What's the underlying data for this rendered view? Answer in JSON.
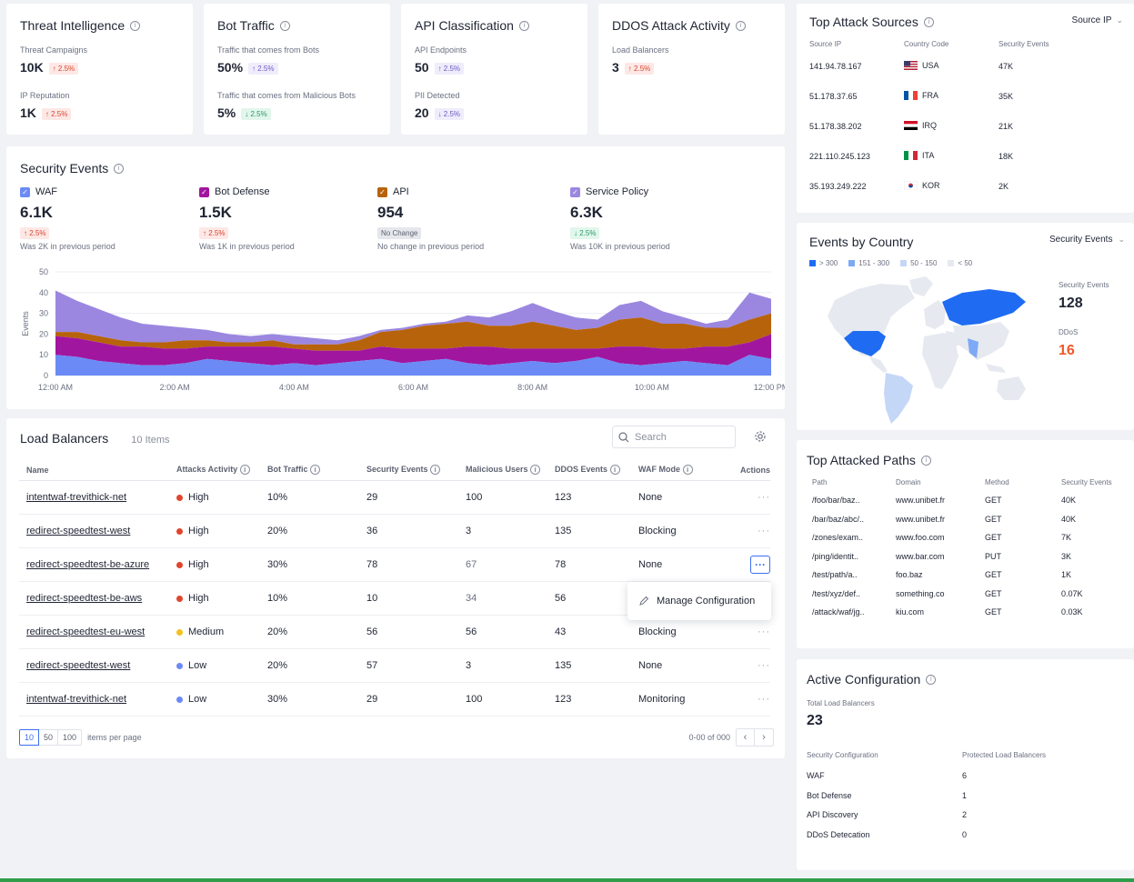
{
  "kpis": [
    {
      "title": "Threat Intelligence",
      "items": [
        {
          "label": "Threat Campaigns",
          "value": "10K",
          "delta": "↑ 2.5%",
          "tone": "red"
        },
        {
          "label": "IP Reputation",
          "value": "1K",
          "delta": "↑ 2.5%",
          "tone": "red"
        }
      ]
    },
    {
      "title": "Bot Traffic",
      "items": [
        {
          "label": "Traffic that comes from Bots",
          "value": "50%",
          "delta": "↑ 2.5%",
          "tone": "purple"
        },
        {
          "label": "Traffic that comes from Malicious Bots",
          "value": "5%",
          "delta": "↓ 2.5%",
          "tone": "green"
        }
      ]
    },
    {
      "title": "API Classification",
      "items": [
        {
          "label": "API Endpoints",
          "value": "50",
          "delta": "↑ 2.5%",
          "tone": "purple"
        },
        {
          "label": "PII Detected",
          "value": "20",
          "delta": "↓ 2.5%",
          "tone": "purple"
        }
      ]
    },
    {
      "title": "DDOS Attack Activity",
      "items": [
        {
          "label": "Load Balancers",
          "value": "3",
          "delta": "↑ 2.5%",
          "tone": "red"
        }
      ]
    }
  ],
  "security_events": {
    "title": "Security Events",
    "metrics": [
      {
        "label": "WAF",
        "value": "6.1K",
        "delta": "↑ 2.5%",
        "tone": "red",
        "note": "Was 2K in previous period",
        "color": "#6b8af5"
      },
      {
        "label": "Bot Defense",
        "value": "1.5K",
        "delta": "↑ 2.5%",
        "tone": "red",
        "note": "Was 1K in previous period",
        "color": "#a1169f"
      },
      {
        "label": "API",
        "value": "954",
        "delta": "No Change",
        "tone": "gray",
        "note": "No change in previous period",
        "color": "#b7630c"
      },
      {
        "label": "Service Policy",
        "value": "6.3K",
        "delta": "↓ 2.5%",
        "tone": "green",
        "note": "Was 10K in previous period",
        "color": "#9b87e0"
      }
    ]
  },
  "chart_data": {
    "type": "area",
    "ylabel": "Events",
    "xlabel": "",
    "ylim": [
      0,
      50
    ],
    "y_ticks": [
      "0",
      "10",
      "20",
      "30",
      "40",
      "50"
    ],
    "x_ticks": [
      "12:00 AM",
      "2:00 AM",
      "4:00 AM",
      "6:00 AM",
      "8:00 AM",
      "10:00 AM",
      "12:00 PM"
    ],
    "grid": true,
    "stacked": true,
    "series": [
      {
        "name": "WAF",
        "color": "#6b8af5",
        "values": [
          10,
          9,
          7,
          6,
          5,
          5,
          6,
          8,
          7,
          6,
          5,
          6,
          5,
          6,
          7,
          8,
          6,
          7,
          8,
          6,
          5,
          6,
          7,
          6,
          7,
          9,
          6,
          5,
          6,
          7,
          6,
          5,
          10,
          8
        ]
      },
      {
        "name": "Bot Defense",
        "color": "#a1169f",
        "values": [
          9,
          9,
          9,
          8,
          9,
          8,
          7,
          6,
          7,
          8,
          9,
          7,
          7,
          6,
          5,
          6,
          7,
          6,
          5,
          8,
          9,
          7,
          6,
          7,
          6,
          4,
          8,
          9,
          7,
          6,
          8,
          9,
          6,
          12
        ]
      },
      {
        "name": "API",
        "color": "#b7630c",
        "values": [
          2,
          3,
          3,
          3,
          2,
          3,
          4,
          3,
          2,
          2,
          3,
          2,
          3,
          3,
          5,
          7,
          9,
          11,
          12,
          12,
          10,
          11,
          13,
          11,
          9,
          10,
          13,
          14,
          12,
          12,
          9,
          9,
          11,
          10
        ]
      },
      {
        "name": "Service Policy",
        "color": "#9b87e0",
        "values": [
          20,
          15,
          13,
          11,
          9,
          8,
          6,
          5,
          4,
          3,
          3,
          4,
          3,
          2,
          2,
          1,
          1,
          1,
          1,
          3,
          4,
          7,
          9,
          7,
          6,
          4,
          7,
          8,
          6,
          3,
          2,
          4,
          13,
          7
        ]
      }
    ]
  },
  "load_balancers": {
    "title": "Load Balancers",
    "count": "10 Items",
    "search_placeholder": "Search",
    "columns": [
      "Name",
      "Attacks Activity",
      "Bot Traffic",
      "Security Events",
      "Malicious Users",
      "DDOS Events",
      "WAF Mode",
      "Actions"
    ],
    "rows": [
      {
        "name": "intentwaf-trevithick-net",
        "activity": "High",
        "bot": "10%",
        "events": "29",
        "users": "100",
        "ddos": "123",
        "mode": "None",
        "level": "high"
      },
      {
        "name": "redirect-speedtest-west",
        "activity": "High",
        "bot": "20%",
        "events": "36",
        "users": "3",
        "ddos": "135",
        "mode": "Blocking",
        "level": "high"
      },
      {
        "name": "redirect-speedtest-be-azure",
        "activity": "High",
        "bot": "30%",
        "events": "78",
        "users": "67",
        "ddos": "78",
        "mode": "None",
        "level": "high"
      },
      {
        "name": "redirect-speedtest-be-aws",
        "activity": "High",
        "bot": "10%",
        "events": "10",
        "users": "34",
        "ddos": "56",
        "mode": "",
        "level": "high"
      },
      {
        "name": "redirect-speedtest-eu-west",
        "activity": "Medium",
        "bot": "20%",
        "events": "56",
        "users": "56",
        "ddos": "43",
        "mode": "Blocking",
        "level": "medium"
      },
      {
        "name": "redirect-speedtest-west",
        "activity": "Low",
        "bot": "20%",
        "events": "57",
        "users": "3",
        "ddos": "135",
        "mode": "None",
        "level": "low"
      },
      {
        "name": "intentwaf-trevithick-net",
        "activity": "Low",
        "bot": "30%",
        "events": "29",
        "users": "100",
        "ddos": "123",
        "mode": "Monitoring",
        "level": "low"
      }
    ],
    "menu_item": "Manage Configuration",
    "page_sizes": [
      "10",
      "50",
      "100"
    ],
    "per_page_label": "items per page",
    "range_label": "0-00 of 000",
    "level_colors": {
      "high": "#e0452d",
      "medium": "#f4c21f",
      "low": "#6b8af5"
    }
  },
  "top_sources": {
    "title": "Top Attack Sources",
    "dropdown": "Source IP",
    "columns": [
      "Source IP",
      "Country Code",
      "Security Events"
    ],
    "rows": [
      {
        "ip": "141.94.78.167",
        "country": "USA",
        "events": "47K"
      },
      {
        "ip": "51.178.37.65",
        "country": "FRA",
        "events": "35K"
      },
      {
        "ip": "51.178.38.202",
        "country": "IRQ",
        "events": "21K"
      },
      {
        "ip": "221.110.245.123",
        "country": "ITA",
        "events": "18K"
      },
      {
        "ip": "35.193.249.222",
        "country": "KOR",
        "events": "2K"
      }
    ]
  },
  "events_by_country": {
    "title": "Events by Country",
    "dropdown": "Security Events",
    "legend": [
      {
        "label": "> 300",
        "color": "#1f6cf2"
      },
      {
        "label": "151 - 300",
        "color": "#7da9f5"
      },
      {
        "label": "50 - 150",
        "color": "#c5d7f7"
      },
      {
        "label": "< 50",
        "color": "#e6e9ef"
      }
    ],
    "stat1_label": "Security Events",
    "stat1_value": "128",
    "stat2_label": "DDoS",
    "stat2_value": "16",
    "accent": "#f0572b"
  },
  "top_paths": {
    "title": "Top Attacked Paths",
    "columns": [
      "Path",
      "Domain",
      "Method",
      "Security Events"
    ],
    "rows": [
      {
        "path": "/foo/bar/baz..",
        "domain": "www.unibet.fr",
        "method": "GET",
        "events": "40K"
      },
      {
        "path": "/bar/baz/abc/..",
        "domain": "www.unibet.fr",
        "method": "GET",
        "events": "40K"
      },
      {
        "path": "/zones/exam..",
        "domain": "www.foo.com",
        "method": "GET",
        "events": "7K"
      },
      {
        "path": "/ping/identit..",
        "domain": "www.bar.com",
        "method": "PUT",
        "events": "3K"
      },
      {
        "path": "/test/path/a..",
        "domain": "foo.baz",
        "method": "GET",
        "events": "1K"
      },
      {
        "path": "/test/xyz/def..",
        "domain": "something.co",
        "method": "GET",
        "events": "0.07K"
      },
      {
        "path": "/attack/waf/jg..",
        "domain": "kiu.com",
        "method": "GET",
        "events": "0.03K"
      }
    ]
  },
  "active_config": {
    "title": "Active Configuration",
    "total_label": "Total Load Balancers",
    "total_value": "23",
    "columns": [
      "Security Configuration",
      "Protected Load Balancers"
    ],
    "rows": [
      {
        "name": "WAF",
        "value": "6"
      },
      {
        "name": "Bot Defense",
        "value": "1"
      },
      {
        "name": "API Discovery",
        "value": "2"
      },
      {
        "name": "DDoS Detecation",
        "value": "0"
      }
    ]
  }
}
